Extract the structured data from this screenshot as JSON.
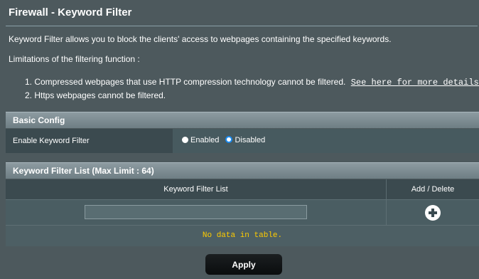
{
  "page": {
    "title": "Firewall - Keyword Filter",
    "description": "Keyword Filter allows you to block the clients' access to webpages containing the specified keywords.",
    "limitations_title": "Limitations of the filtering function :",
    "limitations": [
      {
        "text": "1. Compressed webpages that use HTTP compression technology cannot be filtered.",
        "link": "See here for more details."
      },
      {
        "text": "2. Https webpages cannot be filtered."
      }
    ]
  },
  "basic_config": {
    "header": "Basic Config",
    "label": "Enable Keyword Filter",
    "options": [
      {
        "label": "Enabled",
        "checked": false
      },
      {
        "label": "Disabled",
        "checked": true
      }
    ]
  },
  "keyword_list": {
    "header": "Keyword Filter List (Max Limit : 64)",
    "col_list": "Keyword Filter List",
    "col_action": "Add / Delete",
    "input_value": "",
    "add_icon": "plus-circle-icon",
    "empty_text": "No data in table."
  },
  "actions": {
    "apply_label": "Apply"
  },
  "colors": {
    "background": "#4d595d",
    "empty_text": "#ffcc00",
    "radio_accent": "#1a8bf0"
  }
}
